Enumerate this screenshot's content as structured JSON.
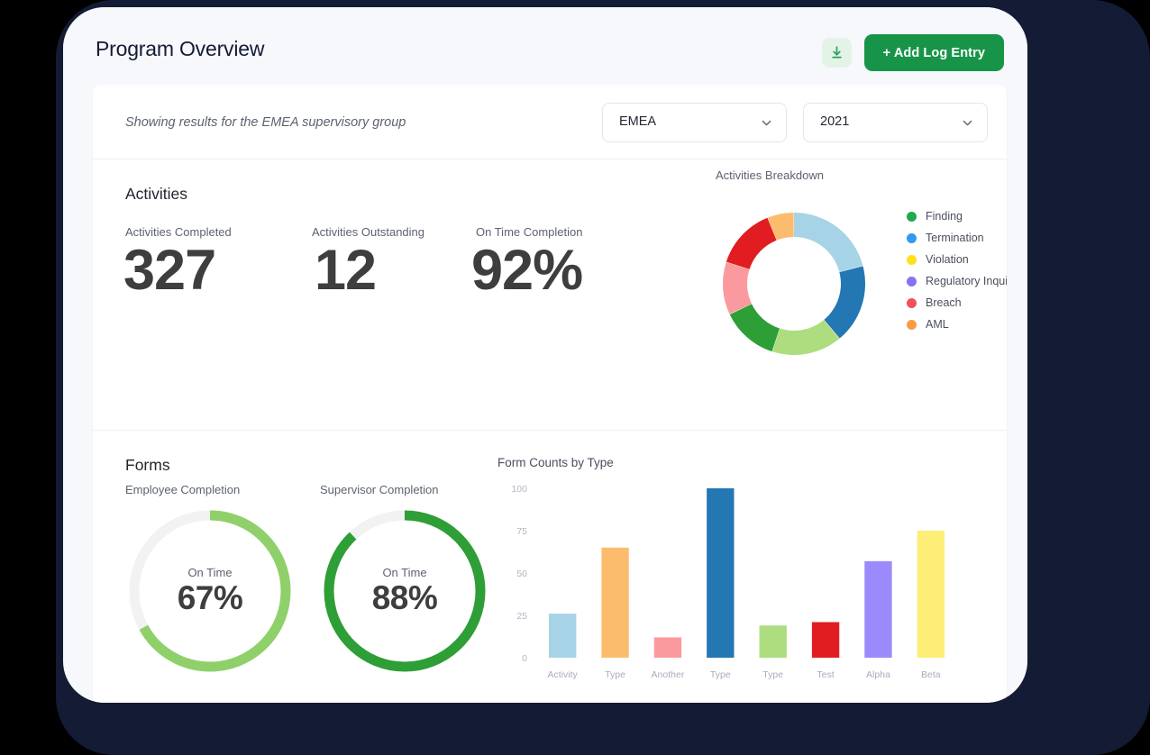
{
  "header": {
    "title": "Program Overview",
    "download_icon": "download-icon",
    "add_entry_label": "+ Add Log Entry",
    "accent_green": "#189449",
    "download_bg": "#e3f4e7"
  },
  "filters": {
    "caption": "Showing results for the EMEA supervisory group",
    "region": {
      "value": "EMEA"
    },
    "year": {
      "value": "2021"
    }
  },
  "activities": {
    "section_title": "Activities",
    "metrics": [
      {
        "label": "Activities Completed",
        "value": "327"
      },
      {
        "label": "Activities Outstanding",
        "value": "12"
      },
      {
        "label": "On Time Completion",
        "value": "92%"
      }
    ]
  },
  "forms": {
    "section_title": "Forms",
    "gauges": [
      {
        "label": "Employee Completion",
        "caption": "On Time",
        "value": "67%",
        "percent": 67,
        "color": "#8fd06a"
      },
      {
        "label": "Supervisor Completion",
        "caption": "On Time",
        "value": "88%",
        "percent": 88,
        "color": "#2e9e36"
      }
    ],
    "gauge_track_color": "#f2f2f2"
  },
  "chart_data": [
    {
      "type": "pie",
      "title": "Activities Breakdown",
      "legend_position": "right",
      "labels": [
        "Finding",
        "Termination",
        "Violation",
        "Regulatory Inquiry",
        "Breach",
        "AML"
      ],
      "legend_colors": [
        "#1faa4c",
        "#3399ee",
        "#ffe01b",
        "#8b6ff5",
        "#f0525c",
        "#f79c42"
      ],
      "segments": [
        {
          "name": "Termination (light)",
          "value": 21,
          "color": "#a6d3e5"
        },
        {
          "name": "Termination",
          "value": 18,
          "color": "#2377b3"
        },
        {
          "name": "Finding (light)",
          "value": 16,
          "color": "#addd7e"
        },
        {
          "name": "Finding",
          "value": 13,
          "color": "#2e9e36"
        },
        {
          "name": "Breach (light)",
          "value": 12,
          "color": "#fb9a9e"
        },
        {
          "name": "Breach",
          "value": 14,
          "color": "#e11d21"
        },
        {
          "name": "AML",
          "value": 6,
          "color": "#fcbc6d"
        }
      ]
    },
    {
      "type": "bar",
      "title": "Form Counts by Type",
      "xlabel": "",
      "ylabel": "",
      "ylim": [
        0,
        100
      ],
      "yticks": [
        0,
        25,
        50,
        75,
        100
      ],
      "grid": false,
      "categories": [
        "Activity",
        "Type",
        "Another",
        "Type",
        "Type",
        "Test",
        "Alpha",
        "Beta"
      ],
      "values": [
        26,
        65,
        12,
        100,
        19,
        21,
        57,
        75
      ],
      "colors": [
        "#a6d3e5",
        "#fcbc6d",
        "#fb9a9e",
        "#2377b3",
        "#addd7e",
        "#e11d21",
        "#9b8afb",
        "#fdee77"
      ]
    }
  ]
}
